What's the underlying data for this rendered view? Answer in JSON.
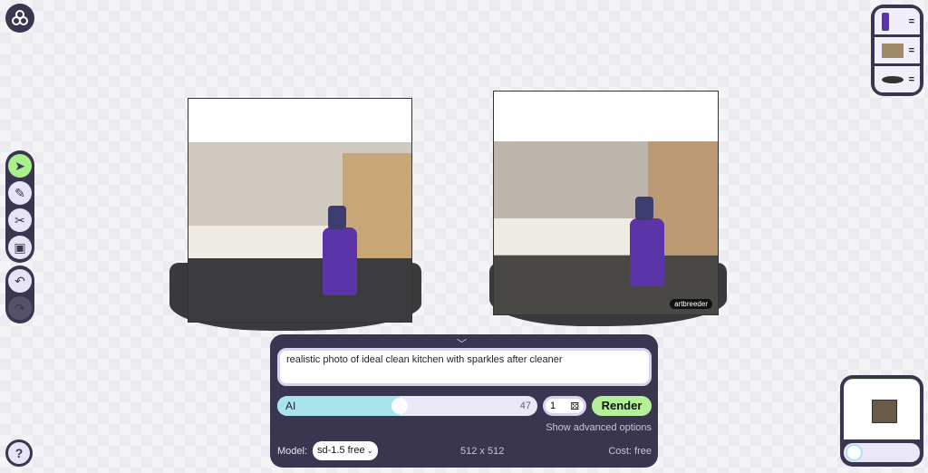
{
  "toolbar": {
    "tools": [
      {
        "name": "select",
        "icon": "cursor-icon",
        "active": true
      },
      {
        "name": "brush",
        "icon": "brush-icon"
      },
      {
        "name": "cut",
        "icon": "scissors-icon"
      },
      {
        "name": "image",
        "icon": "image-icon"
      }
    ],
    "history": [
      {
        "name": "undo",
        "icon": "undo-icon"
      },
      {
        "name": "redo",
        "icon": "redo-icon",
        "disabled": true
      }
    ]
  },
  "help": {
    "label": "?"
  },
  "canvas": {
    "watermark": "artbreeder"
  },
  "prompt_panel": {
    "prompt": "realistic photo of ideal clean kitchen with sparkles after cleaner",
    "ai_slider": {
      "label": "AI",
      "value": 47,
      "max": 100
    },
    "seed": "1",
    "render_label": "Render",
    "advanced_label": "Show advanced options",
    "model_label": "Model:",
    "model_value": "sd-1.5 free",
    "size": "512 x 512",
    "cost": "Cost: free"
  },
  "layers": [
    {
      "name": "spray-bottle",
      "handle": "="
    },
    {
      "name": "kitchen",
      "handle": "="
    },
    {
      "name": "shadow",
      "handle": "="
    }
  ],
  "colors": {
    "panel": "#3b3650",
    "accent_green": "#b4f09a",
    "accent_cyan": "#a9e4ec"
  }
}
